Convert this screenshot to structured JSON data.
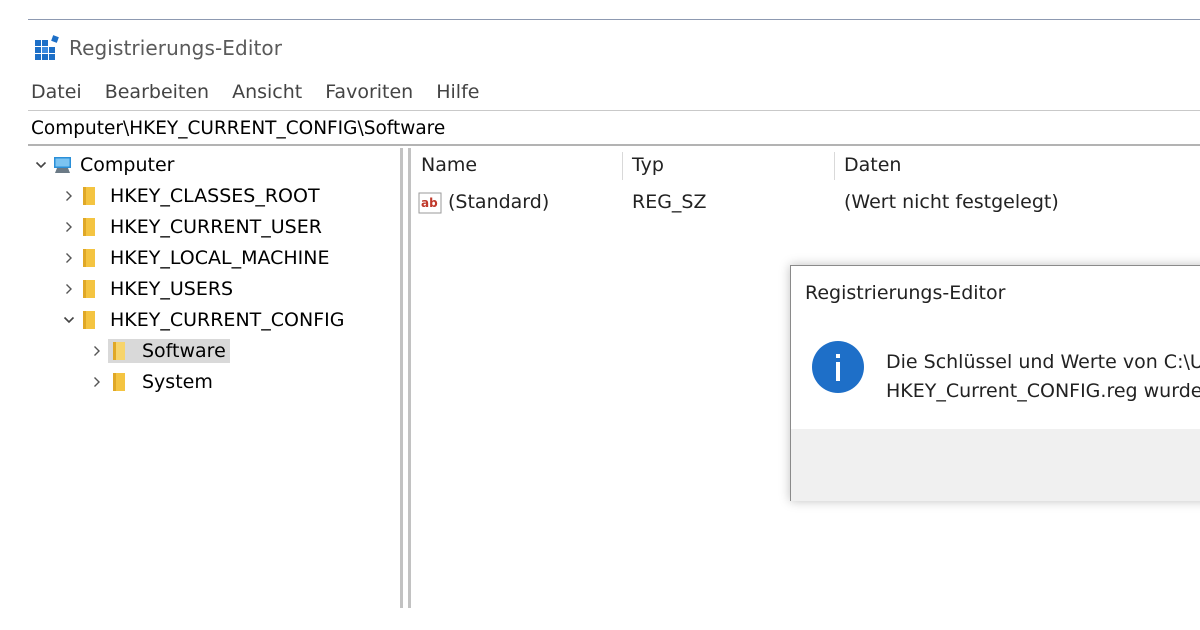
{
  "window": {
    "title": "Registrierungs-Editor",
    "icon": "regedit-icon"
  },
  "menu": [
    "Datei",
    "Bearbeiten",
    "Ansicht",
    "Favoriten",
    "Hilfe"
  ],
  "address": "Computer\\HKEY_CURRENT_CONFIG\\Software",
  "tree": {
    "root": "Computer",
    "hives": [
      "HKEY_CLASSES_ROOT",
      "HKEY_CURRENT_USER",
      "HKEY_LOCAL_MACHINE",
      "HKEY_USERS",
      "HKEY_CURRENT_CONFIG"
    ],
    "expanded_children": [
      "Software",
      "System"
    ],
    "selected": "Software"
  },
  "list": {
    "columns": [
      "Name",
      "Typ",
      "Daten"
    ],
    "rows": [
      {
        "name": "(Standard)",
        "type": "REG_SZ",
        "data": "(Wert nicht festgelegt)",
        "icon": "string-value-icon"
      }
    ]
  },
  "dialog": {
    "title": "Registrierungs-Editor",
    "icon": "info-icon",
    "message_line1": "Die Schlüssel und Werte von C:\\Us",
    "message_line2": "HKEY_Current_CONFIG.reg wurden"
  },
  "colors": {
    "folder": "#f4c441",
    "info": "#1e6fc8",
    "selection": "#d9d9d9"
  }
}
